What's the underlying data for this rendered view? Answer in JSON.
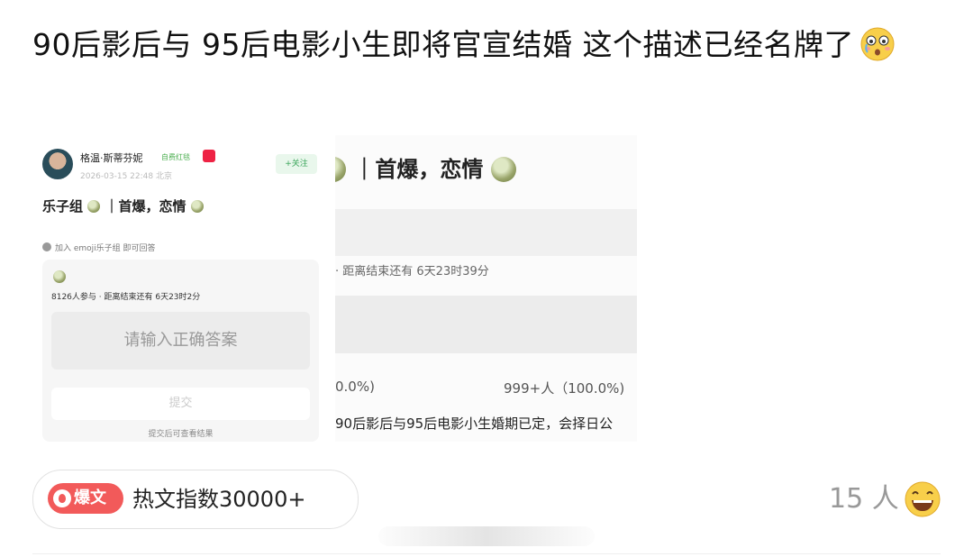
{
  "post": {
    "text": "90后影后与 95后电影小生即将官宣结婚 这个描述已经名牌了",
    "emoji": "flushed-teary-face"
  },
  "image_left": {
    "username": "格温·斯蒂芬妮",
    "verify_tag": "自费红毯",
    "time": "2026-03-15 22:48 北京",
    "follow": "+关注",
    "title_prefix": "乐子组",
    "title_rest": "｜首爆，恋情",
    "hint": "加入 emoji乐子组 即可回答",
    "participants": "8126人参与 · 距离结束还有 6天23时2分",
    "answer_placeholder": "请输入正确答案",
    "submit": "提交",
    "submit_note": "提交后可查看结果"
  },
  "image_right": {
    "title": "｜首爆，恋情",
    "countdown": "· 距离结束还有 6天23时39分",
    "pct_left": "0.0%)",
    "pct_right": "999+人（100.0%)",
    "result": "90后影后与95后电影小生婚期已定，会择日公"
  },
  "footer": {
    "hot_tag": "爆文",
    "hot_text": "热文指数30000+",
    "count": "15 人",
    "reaction_icon": "laughing-face"
  }
}
